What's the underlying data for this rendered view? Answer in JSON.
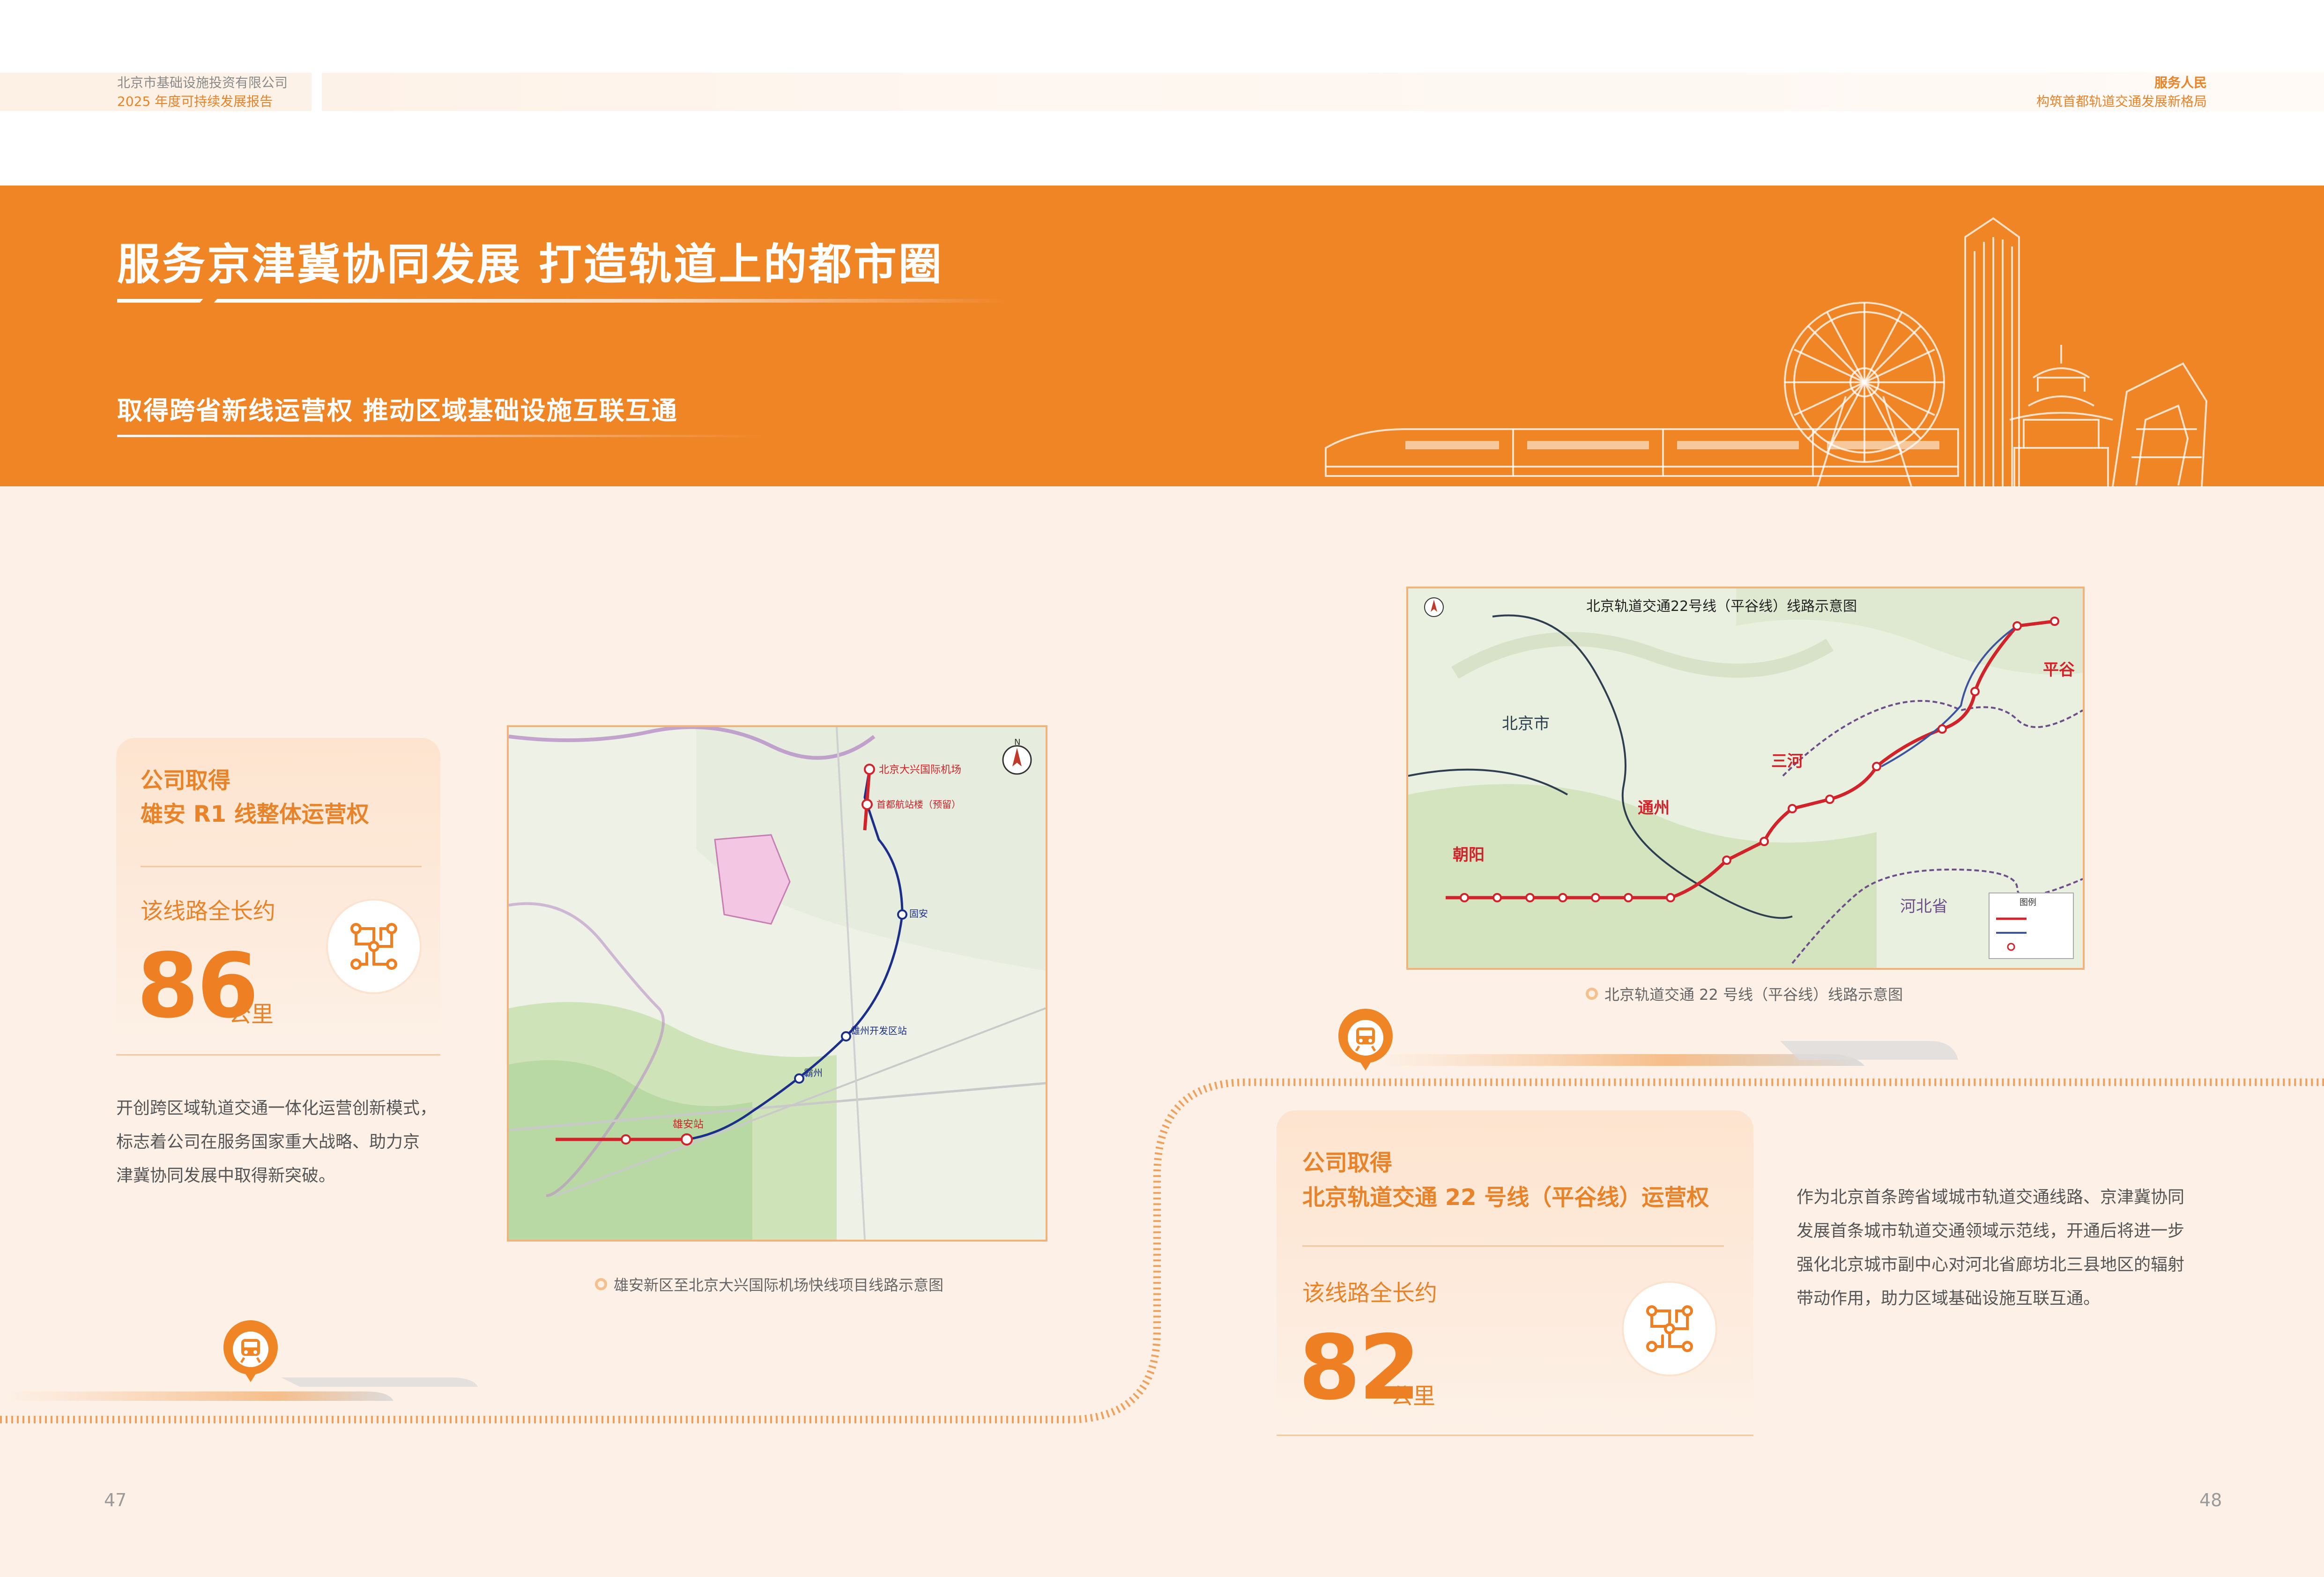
{
  "header": {
    "company": "北京市基础设施投资有限公司",
    "report": "2025 年度可持续发展报告",
    "section": "服务人民",
    "subsection": "构筑首都轨道交通发展新格局"
  },
  "banner": {
    "title": "服务京津冀协同发展  打造轨道上的都市圈",
    "subtitle": "取得跨省新线运营权  推动区域基础设施互联互通"
  },
  "left_card": {
    "title_line1": "公司取得",
    "title_line2": "雄安 R1 线整体运营权",
    "length_label": "该线路全长约",
    "length_value": "86",
    "unit": "公里",
    "paragraph_lines": [
      "开创跨区域轨道交通一体化运营创新模式，",
      "标志着公司在服务国家重大战略、助力京",
      "津冀协同发展中取得新突破。"
    ]
  },
  "left_map": {
    "caption": "雄安新区至北京大兴国际机场快线项目线路示意图",
    "stations": [
      "北京大兴国际机场",
      "首都航站楼（预留）",
      "固安",
      "雄安站",
      "霸州",
      "雄州开发区站"
    ]
  },
  "right_map": {
    "title": "北京轨道交通22号线（平谷线）线路示意图",
    "caption": "北京轨道交通 22 号线（平谷线）线路示意图",
    "labels": {
      "beijing": "北京市",
      "tongzhou": "通州",
      "chaoyang": "朝阳",
      "sanhe": "三河",
      "pinggu": "平谷",
      "hebei": "河北省",
      "legend": "图例"
    }
  },
  "right_card": {
    "title_line1": "公司取得",
    "title_line2": "北京轨道交通 22 号线（平谷线）运营权",
    "length_label": "该线路全长约",
    "length_value": "82",
    "unit": "公里",
    "paragraph_lines": [
      "作为北京首条跨省域城市轨道交通线路、京津冀协同",
      "发展首条城市轨道交通领域示范线，开通后将进一步",
      "强化北京城市副中心对河北省廊坊北三县地区的辐射",
      "带动作用，助力区域基础设施互联互通。"
    ]
  },
  "pages": {
    "left": "47",
    "right": "48"
  },
  "colors": {
    "accent": "#f08526",
    "background": "#fdf1e7",
    "text": "#555555"
  }
}
